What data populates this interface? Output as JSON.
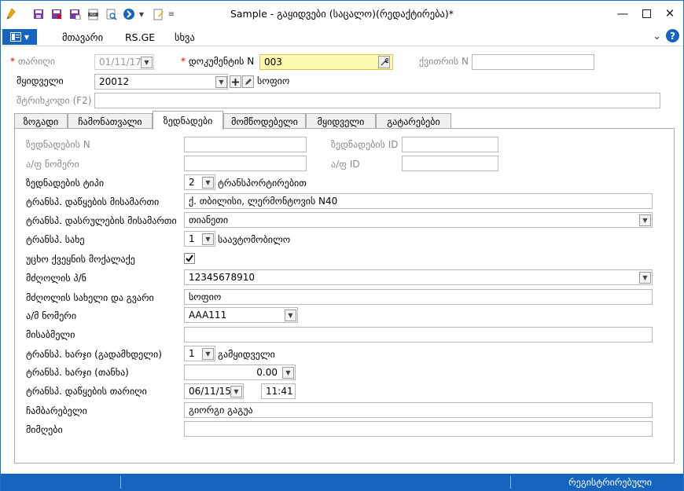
{
  "window": {
    "title": "Sample - გაყიდვები (საცალო)(რედაქტირება)*"
  },
  "menu": {
    "items": [
      "მთავარი",
      "RS.GE",
      "სხვა"
    ]
  },
  "header": {
    "date_label": "თარიღი",
    "date_value": "01/11/17",
    "docnum_label": "დოკუმენტის N",
    "docnum_value": "003",
    "invoice_label": "ქვითრის N",
    "invoice_value": "",
    "buyer_label": "მყიდველი",
    "buyer_value": "20012",
    "buyer_name": "სოფიო",
    "barcode_label": "შტრიხკოდი (F2)",
    "barcode_value": ""
  },
  "tabs": [
    "ზოგადი",
    "ჩამონათვალი",
    "ზედნადები",
    "მომწოდებელი",
    "მყიდველი",
    "გატარებები"
  ],
  "waybill": {
    "number_label": "ზედნადების N",
    "number_value": "",
    "id_label": "ზედნადების ID",
    "id_value": "",
    "invoice_num_label": "ა/ფ ნომერი",
    "invoice_num_value": "",
    "invoice_id_label": "ა/ფ ID",
    "invoice_id_value": "",
    "type_label": "ზედნადების ტიპი",
    "type_num": "2",
    "type_text": "ტრანსპორტირებით",
    "start_addr_label": "ტრანსპ. დაწყების მისამართი",
    "start_addr_value": "ქ. თბილისი, ლერმონტოვის N40",
    "end_addr_label": "ტრანსპ. დასრულების მისამართი",
    "end_addr_value": "თიანეთი",
    "transport_type_label": "ტრანსპ. სახე",
    "transport_type_num": "1",
    "transport_type_text": "საავტომობილო",
    "foreign_label": "უცხო ქვეყნის მოქალაქე",
    "foreign_checked": true,
    "driver_id_label": "მძღოლის პ/ნ",
    "driver_id_value": "12345678910",
    "driver_name_label": "მძღოლის სახელი და გვარი",
    "driver_name_value": "სოფიო",
    "car_num_label": "ა/მ ნომერი",
    "car_num_value": "AAA111",
    "receiver_addr_label": "მისაბმელი",
    "receiver_addr_value": "",
    "cost_payer_label": "ტრანსპ. ხარჯი (გადამხდელი)",
    "cost_payer_num": "1",
    "cost_payer_text": "გამყიდველი",
    "cost_amount_label": "ტრანსპ. ხარჯი (თანხა)",
    "cost_amount_value": "0.00",
    "start_date_label": "ტრანსპ. დაწყების თარიღი",
    "start_date_value": "06/11/15",
    "start_time_value": "11:41",
    "shipper_label": "ჩამბარებელი",
    "shipper_value": "გიორგი გაგუა",
    "recipient_label": "მიმღები",
    "recipient_value": ""
  },
  "status": {
    "text": "რეგისტრირებული"
  },
  "colors": {
    "accent": "#1565c0",
    "required": "#dd0000",
    "highlight": "#fff9b0"
  },
  "icons": [
    "pencil-icon",
    "save-icon",
    "save-close-icon",
    "save-new-icon",
    "pdf-icon",
    "preview-icon",
    "navigate-icon",
    "edit-document-icon",
    "checkmark-icon",
    "wrench-icon",
    "plus-icon",
    "edit-icon",
    "help-icon"
  ]
}
